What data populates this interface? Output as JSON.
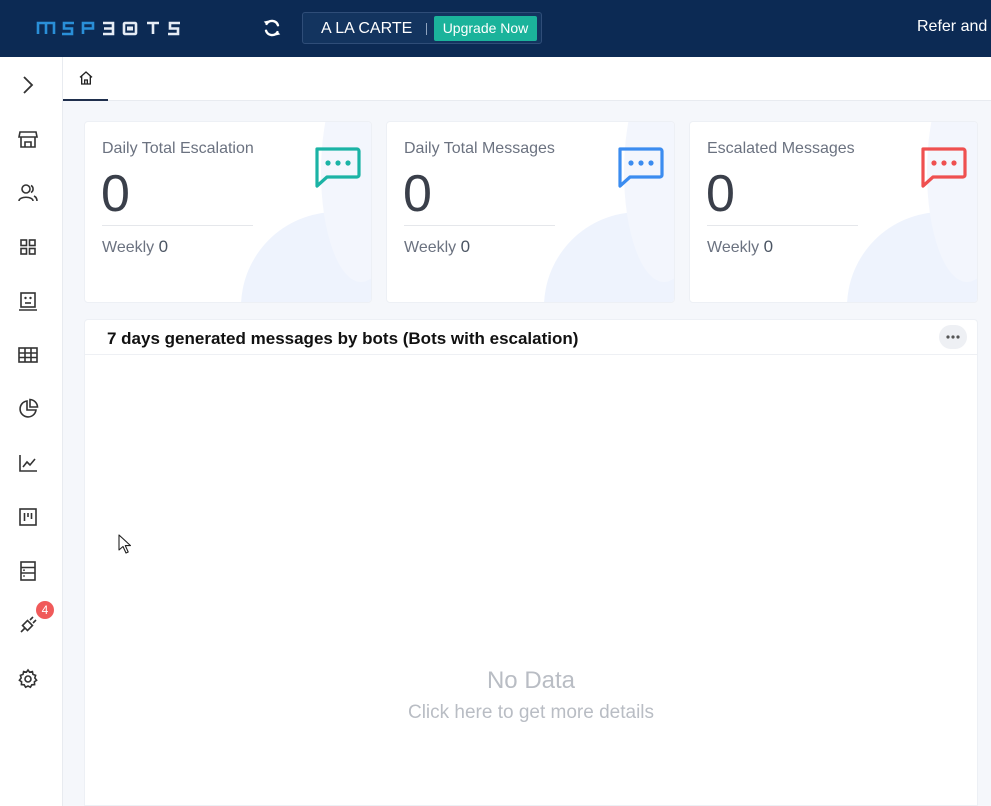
{
  "header": {
    "plan_name": "A LA CARTE",
    "upgrade_label": "Upgrade Now",
    "refer_label": "Refer and",
    "icons": [
      "mspbots-logo",
      "sync-icon"
    ]
  },
  "sidebar": {
    "icons": [
      "expand-chevron-icon",
      "store-icon",
      "users-icon",
      "dashboard-grid-icon",
      "bot-face-icon",
      "table-icon",
      "pie-chart-icon",
      "line-chart-icon",
      "kanban-icon",
      "report-icon",
      "integration-plug-icon",
      "settings-gear-icon"
    ],
    "integration_badge": "4"
  },
  "tabs": {
    "home_icon": "home-icon"
  },
  "cards": [
    {
      "title": "Daily Total Escalation",
      "value": "0",
      "weekly_label": "Weekly",
      "weekly_value": "0",
      "icon_color": "#1bb3a5"
    },
    {
      "title": "Daily Total Messages",
      "value": "0",
      "weekly_label": "Weekly",
      "weekly_value": "0",
      "icon_color": "#3b8cf0"
    },
    {
      "title": "Escalated Messages",
      "value": "0",
      "weekly_label": "Weekly",
      "weekly_value": "0",
      "icon_color": "#ef5050"
    }
  ],
  "panel": {
    "title": "7 days generated messages by bots (Bots with escalation)",
    "empty_title": "No Data",
    "empty_link": "Click here to get more details"
  },
  "colors": {
    "topbar": "#0c2a54",
    "accent": "#1bb39b"
  }
}
